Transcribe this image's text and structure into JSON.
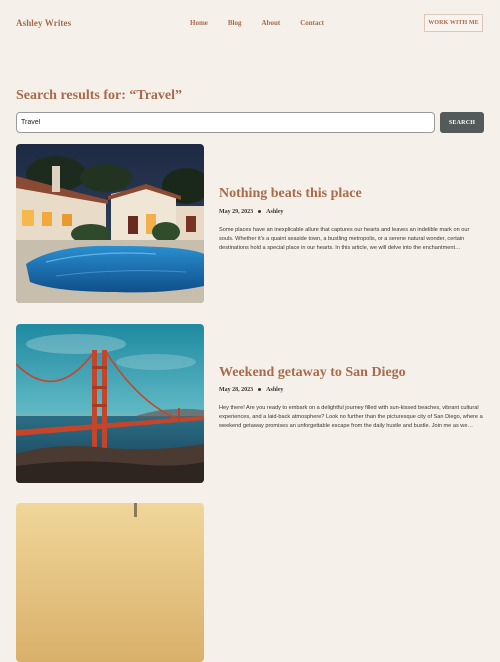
{
  "header": {
    "brand": "Ashley Writes",
    "nav": [
      "Home",
      "Blog",
      "About",
      "Contact"
    ],
    "cta_label": "WORK WITH ME"
  },
  "search": {
    "heading": "Search results for: “Travel”",
    "input_value": "Travel",
    "button_label": "SEARCH"
  },
  "results": [
    {
      "title": "Nothing beats this place",
      "date": "May 29, 2023",
      "author": "Ashley",
      "excerpt": "Some places have an inexplicable allure that captures our hearts and leaves an indelible mark on our souls. Whether it’s a quaint seaside town, a bustling metropolis, or a serene natural wonder, certain destinations hold a special place in our hearts. In this article, we will delve into the enchantment…",
      "image": "villa-pool-at-dusk-image"
    },
    {
      "title": "Weekend getaway to San Diego",
      "date": "May 28, 2023",
      "author": "Ashley",
      "excerpt": "Hey there! Are you ready to embark on a delightful journey filled with sun-kissed beaches, vibrant cultural experiences, and a laid-back atmosphere? Look no further than the picturesque city of San Diego, where a weekend getaway promises an unforgettable escape from the daily hustle and bustle. Join me as we…",
      "image": "golden-gate-bridge-image"
    },
    {
      "image": "desert-landscape-image"
    }
  ],
  "colors": {
    "background": "#f5f1ea",
    "accent": "#a86b4b",
    "text": "#3b3530",
    "button": "#535a59"
  }
}
